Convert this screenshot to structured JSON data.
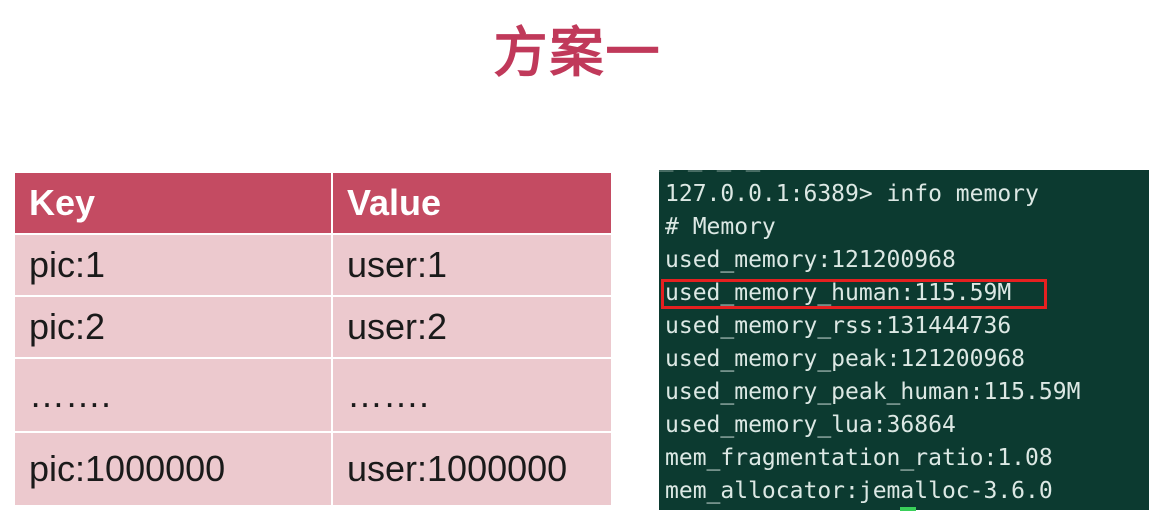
{
  "title": "方案一",
  "table": {
    "headers": [
      "Key",
      "Value"
    ],
    "rows": [
      [
        "pic:1",
        "user:1"
      ],
      [
        "pic:2",
        "user:2"
      ],
      [
        "…….",
        "……."
      ],
      [
        "pic:1000000",
        "user:1000000"
      ]
    ]
  },
  "terminal": {
    "lines": [
      "127.0.0.1:6389> info memory",
      "# Memory",
      "used_memory:121200968",
      "used_memory_human:115.59M",
      "used_memory_rss:131444736",
      "used_memory_peak:121200968",
      "used_memory_peak_human:115.59M",
      "used_memory_lua:36864",
      "mem_fragmentation_ratio:1.08",
      "mem_allocator:jemalloc-3.6.0"
    ],
    "highlighted_line_index": 3
  },
  "colors": {
    "title": "#c0395a",
    "table_header": "#c44b62",
    "table_cell": "#ecc9ce",
    "terminal_bg": "#0c3a30",
    "highlight": "#e52020"
  }
}
